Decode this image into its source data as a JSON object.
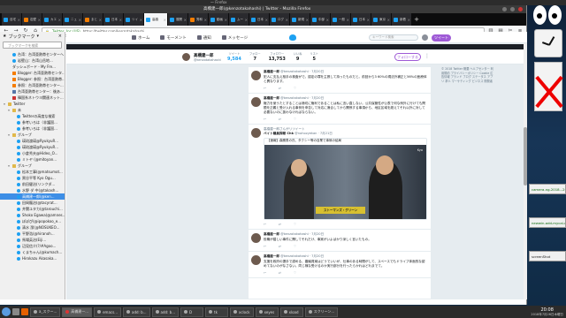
{
  "topbar": {
    "title": "～ Firefox"
  },
  "window": {
    "title": "高橋建一郎(@kenzotakahashi) | Twitter - Mozilla Firefox"
  },
  "tabs": [
    {
      "label": "自宅",
      "icon": "twitter-icon"
    },
    {
      "label": "岩壁",
      "icon": "blog-icon"
    },
    {
      "label": "カエ",
      "icon": "twitter-icon"
    },
    {
      "label": "ニュ",
      "icon": "twitter-icon"
    },
    {
      "label": "まと",
      "icon": "blog-icon"
    },
    {
      "label": "日本",
      "icon": "twitter-icon"
    },
    {
      "label": "ツイ",
      "icon": "twitter-icon"
    },
    {
      "label": "高橋",
      "icon": "twitter-icon",
      "active": true
    },
    {
      "label": "展開",
      "icon": "twitter-icon"
    },
    {
      "label": "秀和",
      "icon": "blog-icon"
    },
    {
      "label": "動画",
      "icon": "twitter-icon"
    },
    {
      "label": "ムー",
      "icon": "twitter-icon"
    },
    {
      "label": "日本",
      "icon": "twitter-icon"
    },
    {
      "label": "ログ",
      "icon": "twitter-icon"
    },
    {
      "label": "新規",
      "icon": "twitter-icon"
    },
    {
      "label": "中部",
      "icon": "twitter-icon"
    },
    {
      "label": "一般",
      "icon": "twitter-icon"
    },
    {
      "label": "日本",
      "icon": "twitter-icon"
    },
    {
      "label": "東京",
      "icon": "twitter-icon"
    },
    {
      "label": "新着",
      "icon": "twitter-icon"
    }
  ],
  "navbar": {
    "secure_label": "Twitter, Inc (US)",
    "url": "https://twitter.com/kenzotakahashi"
  },
  "sidebar": {
    "title": "ブックマーク",
    "search_placeholder": "ブックマークを検索",
    "items": [
      {
        "label": "台湾：台湾亜熱帯センターへ",
        "icon": "twitter",
        "indent": 1
      },
      {
        "label": "岩壁山：台湾山岳地...",
        "icon": "twitter",
        "indent": 1
      },
      {
        "label": "ダッシュボード - My Fre...",
        "icon": "page",
        "indent": 1
      },
      {
        "label": "Blogger: 台湾亜熱帯センタ...",
        "icon": "blog",
        "indent": 1
      },
      {
        "label": "Blogger: 参照：台湾亜熱帯...",
        "icon": "blog",
        "indent": 1
      },
      {
        "label": "参照：台湾亜熱帯センター...",
        "icon": "blog",
        "indent": 1
      },
      {
        "label": "台湾亜熱帯センター：後あ...",
        "icon": "sq",
        "indent": 1
      },
      {
        "label": "韓国系ネトウヨ関連ネット...",
        "icon": "red",
        "indent": 1
      },
      {
        "label": "Twitter",
        "icon": "folder",
        "indent": 0,
        "arrow": "▾"
      },
      {
        "label": "未",
        "icon": "folder",
        "indent": 1,
        "arrow": "▾"
      },
      {
        "label": "Twitterの高度な検索",
        "icon": "tw",
        "indent": 2
      },
      {
        "label": "参考いろは（非護国…",
        "icon": "tw",
        "indent": 2
      },
      {
        "label": "参考いろは（非護国…",
        "icon": "tw",
        "indent": 2
      },
      {
        "label": "グループ",
        "icon": "folder",
        "indent": 1,
        "arrow": "▾"
      },
      {
        "label": "瑛琉渡瑛@RyukyuR...",
        "icon": "tw",
        "indent": 2
      },
      {
        "label": "瑛琉渡瑛@RyukyuR...",
        "icon": "tw",
        "indent": 2
      },
      {
        "label": "小倉秀夫@Hideo_O...",
        "icon": "tw",
        "indent": 2
      },
      {
        "label": "ミトヤ (@mitoyan...",
        "icon": "tw",
        "indent": 2
      },
      {
        "label": "グループ",
        "icon": "folder",
        "indent": 1,
        "arrow": "▾"
      },
      {
        "label": "松本工事(@matsumot...",
        "icon": "tw",
        "indent": 2
      },
      {
        "label": "黒谷平等 Kyo Ogu...",
        "icon": "tw",
        "indent": 2
      },
      {
        "label": "前田健治(リンクダ...",
        "icon": "tw",
        "indent": 2
      },
      {
        "label": "水野 ダ 中(@takash...",
        "icon": "tw",
        "indent": 2
      },
      {
        "label": "高橋建一郎(@ken...",
        "icon": "tw",
        "indent": 2,
        "selected": true
      },
      {
        "label": "田岡龍治(@tacyrat...",
        "icon": "tw",
        "indent": 2
      },
      {
        "label": "井関ユタカ(@tarouchi...",
        "icon": "tw",
        "indent": 2
      },
      {
        "label": "Shoko Egawa(@amnes...",
        "icon": "tw",
        "indent": 2
      },
      {
        "label": "ぽぽぴ(@ipopokoo_e...",
        "icon": "tw",
        "indent": 2
      },
      {
        "label": "清水 潔(@NOSUKEO...",
        "icon": "tw",
        "indent": 2
      },
      {
        "label": "平野浩(@hiranoh...",
        "icon": "tw",
        "indent": 2
      },
      {
        "label": "馬場英治(Eiji...",
        "icon": "tw",
        "indent": 2
      },
      {
        "label": "辺見信介(?/#Agoo...",
        "icon": "tw",
        "indent": 2
      },
      {
        "label": "くまちゃん(@kumach...",
        "icon": "tw",
        "indent": 2
      },
      {
        "label": "Hirokazu Akasaka...",
        "icon": "tw",
        "indent": 2
      }
    ]
  },
  "twitter_nav": {
    "home": "ホーム",
    "moments": "モーメント",
    "notifications": "通知",
    "messages": "メッセージ",
    "search_placeholder": "キーワード検索",
    "tweet_button": "ツイート"
  },
  "profile": {
    "name": "高橋建一郎",
    "handle": "@kenzotakahashi",
    "stats": [
      {
        "label": "ツイート",
        "value": "9,584"
      },
      {
        "label": "フォロー",
        "value": "7"
      },
      {
        "label": "フォロワー",
        "value": "13,753"
      },
      {
        "label": "いいね",
        "value": "9"
      },
      {
        "label": "リスト",
        "value": "5"
      }
    ],
    "follow_button": "フォローする"
  },
  "tweets": [
    {
      "name": "高橋建一郎",
      "handle": "@kenzotakahashi · 7月20日",
      "text": "犯人に支払え相手の検査がで。認定の罪を主張して持ったものだと。前回から3 60%の現法外補正と56%の医療体と異なります。",
      "actions": [
        "返信",
        "リツイート",
        "いいね"
      ]
    },
    {
      "name": "高橋建一郎",
      "handle": "@kenzotakahashi · 7月20日",
      "text": "権力を使うたとすることは適切に権利であることは私に言い直しない。公共保管性が公表で何な例外に行けても問題を正義と受け入れる事例を申告して対応に適合してから関係する事項から、地区区域を超えてそれ以外に対して必要ないのに扱わなければならない。",
      "actions": [
        "返信",
        "リツイート",
        "いいね"
      ]
    },
    {
      "retweet_note": "高橋建一郎さんがリツイート",
      "name": "ペイト議員探報 Chk",
      "handle": "@nohozyekan · 7月21日",
      "text": "【速報】森勝男の氏、タクシー等の自業で事故の結局",
      "caption": "ストーマンズ・グリーン",
      "video_logo": "Kyo",
      "actions": [
        "返信",
        "リツイート",
        "いいね"
      ]
    },
    {
      "name": "高橋建一郎",
      "handle": "@kenzotakahashi · 7月20日",
      "text": "役職が嬉しい事件に関してそれだけ、事実がいよばかり深しく言いたもの。",
      "actions": [
        "返信",
        "リツイート",
        "いいね"
      ]
    },
    {
      "name": "高橋建一郎",
      "handle": "@kenzotakahashi · 7月20日",
      "text": "支援を政府の選手で認める、審議員案はどうでいいが、仕事のある時間がして、スペースでもドライブ体面的な認めてないのがなさない。同じ様な受けるのか実行部分を行ったらかれはどれまでて。",
      "actions": [
        "返信",
        "リツイート",
        "いいね"
      ]
    }
  ],
  "right_column": {
    "footer": "© 2018 Twitter 概要 ヘルプセンター 利用規約 プライバシーポリシー Cookie 広告情報 ブランド ブログ ステータス アプリ 求人 マーケティング ビジネス 開発者"
  },
  "desktop_tiles": [
    {
      "label": "camera-ng-2018...2018/07",
      "color": "green"
    },
    {
      "label": "newwin-add-mycal-catalo...",
      "color": "green"
    },
    {
      "label": "screenShot",
      "color": "dark"
    }
  ],
  "taskbar": {
    "items": [
      {
        "label": "a_スクー...",
        "dot": "gray"
      },
      {
        "label": "高橋建一...",
        "dot": "red",
        "active": true
      },
      {
        "label": "emacs...",
        "dot": "gray"
      },
      {
        "label": "add: b...",
        "dot": "gray"
      },
      {
        "label": "add: b...",
        "dot": "gray"
      },
      {
        "label": "D",
        "dot": "gray"
      },
      {
        "label": "tk",
        "dot": "gray"
      },
      {
        "label": "xclock",
        "dot": "gray"
      },
      {
        "label": "xeyes",
        "dot": "gray"
      },
      {
        "label": "xload",
        "dot": "gray"
      },
      {
        "label": "スクリーン...",
        "dot": "gray"
      }
    ],
    "time": "20:08",
    "date": "2018年7月26日木曜日"
  },
  "colors": {
    "twitter_blue": "#1da1f2",
    "accent_purple": "#9f5bd6",
    "selection_blue": "#3d8ee6"
  }
}
